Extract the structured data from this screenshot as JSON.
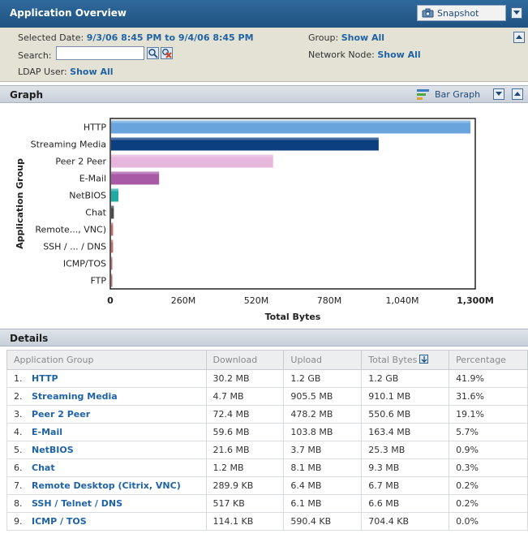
{
  "header": {
    "title": "Application Overview",
    "snapshot_label": "Snapshot"
  },
  "overview": {
    "selected_date_label": "Selected Date:",
    "selected_date_value": "9/3/06 8:45 PM to 9/4/06 8:45 PM",
    "search_label": "Search:",
    "search_value": "",
    "ldap_label": "LDAP User:",
    "ldap_value": "Show All",
    "group_label": "Group:",
    "group_value": "Show All",
    "network_node_label": "Network Node:",
    "network_node_value": "Show All"
  },
  "graph_panel": {
    "title": "Graph",
    "view_label": "Bar Graph"
  },
  "chart_data": {
    "type": "bar",
    "orientation": "horizontal",
    "categories": [
      "HTTP",
      "Streaming Media",
      "Peer 2 Peer",
      "E-Mail",
      "NetBIOS",
      "Chat",
      "Remote..., VNC)",
      "SSH / ... / DNS",
      "ICMP/TOS",
      "FTP"
    ],
    "values": [
      1280,
      953,
      577,
      171,
      26,
      9.7,
      7.0,
      6.9,
      0.7,
      0.7
    ],
    "colors": [
      "#6aa4dc",
      "#0b3f80",
      "#e6b6dc",
      "#a85aa6",
      "#1faaa8",
      "#4a4a4a",
      "#c86a6a",
      "#c86a6a",
      "#c86a6a",
      "#c86a6a"
    ],
    "xlim": [
      0,
      1300
    ],
    "xticks": [
      "0",
      "260M",
      "520M",
      "780M",
      "1,040M",
      "1,300M"
    ],
    "xlabel": "Total Bytes",
    "ylabel": "Application Group"
  },
  "details": {
    "title": "Details",
    "columns": [
      "Application Group",
      "Download",
      "Upload",
      "Total Bytes",
      "Percentage"
    ],
    "rows": [
      {
        "num": "1.",
        "name": "HTTP",
        "download": "30.2 MB",
        "upload": "1.2 GB",
        "total": "1.2 GB",
        "pct": "41.9%"
      },
      {
        "num": "2.",
        "name": "Streaming Media",
        "download": "4.7 MB",
        "upload": "905.5 MB",
        "total": "910.1 MB",
        "pct": "31.6%"
      },
      {
        "num": "3.",
        "name": "Peer 2 Peer",
        "download": "72.4 MB",
        "upload": "478.2 MB",
        "total": "550.6 MB",
        "pct": "19.1%"
      },
      {
        "num": "4.",
        "name": "E-Mail",
        "download": "59.6 MB",
        "upload": "103.8 MB",
        "total": "163.4 MB",
        "pct": "5.7%"
      },
      {
        "num": "5.",
        "name": "NetBIOS",
        "download": "21.6 MB",
        "upload": "3.7 MB",
        "total": "25.3 MB",
        "pct": "0.9%"
      },
      {
        "num": "6.",
        "name": "Chat",
        "download": "1.2 MB",
        "upload": "8.1 MB",
        "total": "9.3 MB",
        "pct": "0.3%"
      },
      {
        "num": "7.",
        "name": "Remote Desktop (Citrix, VNC)",
        "download": "289.9 KB",
        "upload": "6.4 MB",
        "total": "6.7 MB",
        "pct": "0.2%"
      },
      {
        "num": "8.",
        "name": "SSH / Telnet / DNS",
        "download": "517 KB",
        "upload": "6.1 MB",
        "total": "6.6 MB",
        "pct": "0.2%"
      },
      {
        "num": "9.",
        "name": "ICMP / TOS",
        "download": "114.1 KB",
        "upload": "590.4 KB",
        "total": "704.4 KB",
        "pct": "0.0%"
      }
    ]
  }
}
